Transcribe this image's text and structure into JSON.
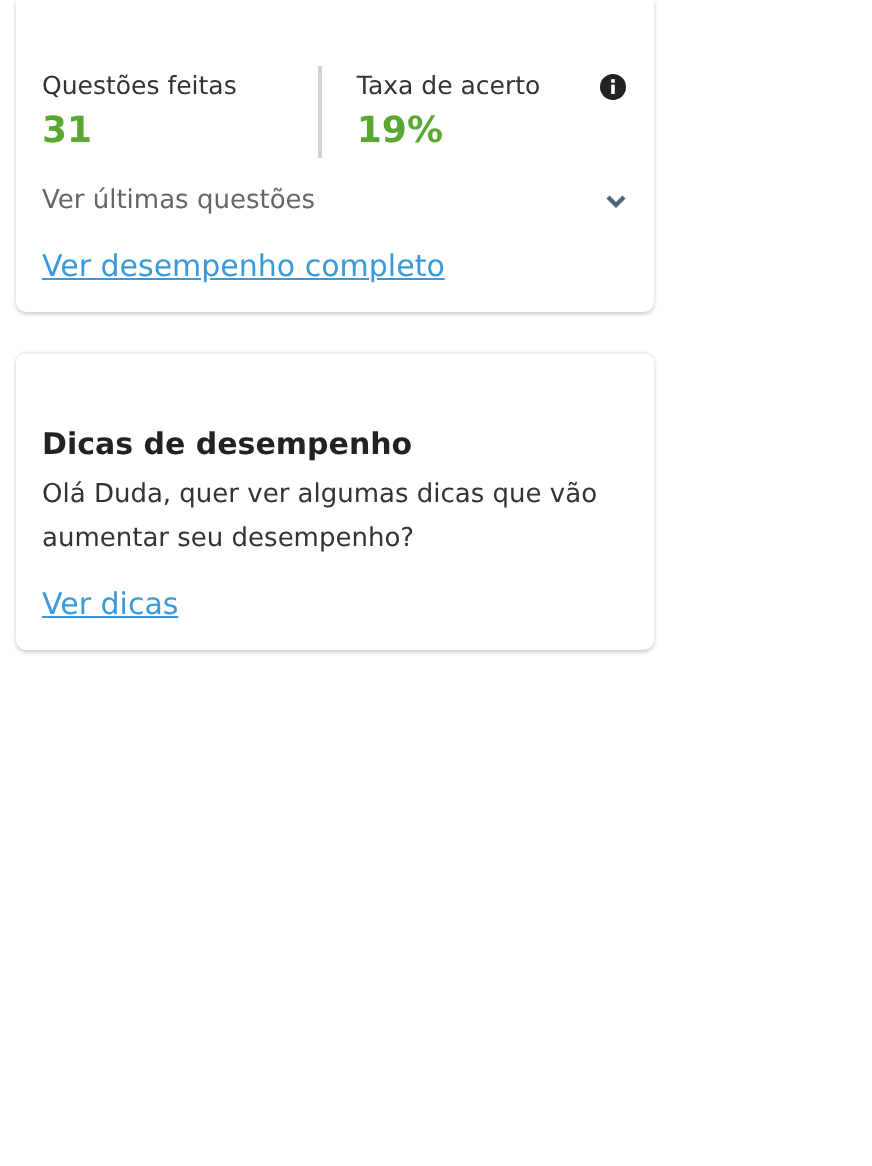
{
  "stats_card": {
    "stats": [
      {
        "label": "Questões feitas",
        "value": "31",
        "info": false
      },
      {
        "label": "Taxa de acerto",
        "value": "19%",
        "info": true
      }
    ],
    "recent_toggle": {
      "label": "Ver últimas questões",
      "expanded": false
    },
    "link": "Ver desempenho completo"
  },
  "tips_card": {
    "title": "Dicas de desempenho",
    "text": "Olá Duda, quer ver algumas dicas que vão aumentar seu desempenho?",
    "link": "Ver dicas"
  }
}
